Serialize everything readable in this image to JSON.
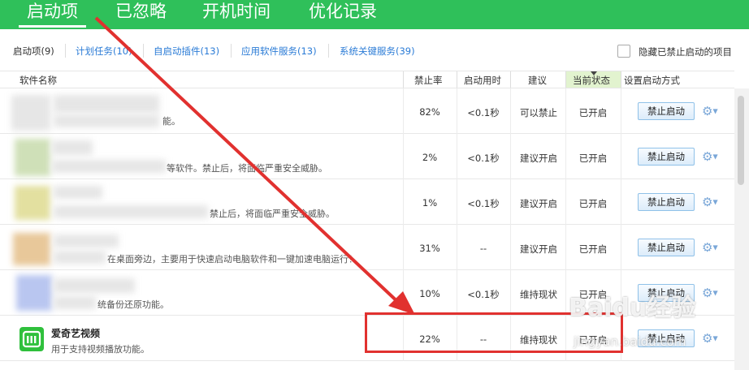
{
  "top_tabs": [
    "启动项",
    "已忽略",
    "开机时间",
    "优化记录"
  ],
  "sub_tabs": [
    "启动项(9)",
    "计划任务(10)",
    "自启动插件(13)",
    "应用软件服务(13)",
    "系统关键服务(39)"
  ],
  "hide_disabled_label": "隐藏已禁止启动的项目",
  "columns": {
    "name": "软件名称",
    "rate": "禁止率",
    "boot_time": "启动用时",
    "suggestion": "建议",
    "state": "当前状态",
    "method": "设置启动方式"
  },
  "rows": [
    {
      "name": "",
      "desc": "能。",
      "rate": "82%",
      "boot_time": "<0.1秒",
      "suggestion": "可以禁止",
      "state": "已开启",
      "action": "禁止启动"
    },
    {
      "name": "",
      "desc": "等软件。禁止后，将面临严重安全威胁。",
      "rate": "2%",
      "boot_time": "<0.1秒",
      "suggestion": "建议开启",
      "state": "已开启",
      "action": "禁止启动"
    },
    {
      "name": "",
      "desc": "禁止后，将面临严重安全威胁。",
      "rate": "1%",
      "boot_time": "<0.1秒",
      "suggestion": "建议开启",
      "state": "已开启",
      "action": "禁止启动"
    },
    {
      "name": "",
      "desc": "在桌面旁边，主要用于快速启动电脑软件和一键加速电脑运行！",
      "rate": "31%",
      "boot_time": "--",
      "suggestion": "建议开启",
      "state": "已开启",
      "action": "禁止启动"
    },
    {
      "name": "",
      "desc": "统备份还原功能。",
      "rate": "10%",
      "boot_time": "<0.1秒",
      "suggestion": "维持现状",
      "state": "已开启",
      "action": "禁止启动"
    },
    {
      "name": "爱奇艺视频",
      "desc": "用于支持视频播放功能。",
      "rate": "22%",
      "boot_time": "--",
      "suggestion": "维持现状",
      "state": "已开启",
      "action": "禁止启动"
    }
  ],
  "watermark": {
    "brand": "Baidu经验",
    "url": "jingyan.baidu.com"
  },
  "colors": {
    "accent_green": "#2fc05a",
    "link_blue": "#2a7bd6",
    "annotation_red": "#e1312f",
    "state_highlight": "#e2f3cf"
  },
  "icons": [
    "gear-icon",
    "iqiyi-app-icon",
    "checkbox-icon"
  ]
}
